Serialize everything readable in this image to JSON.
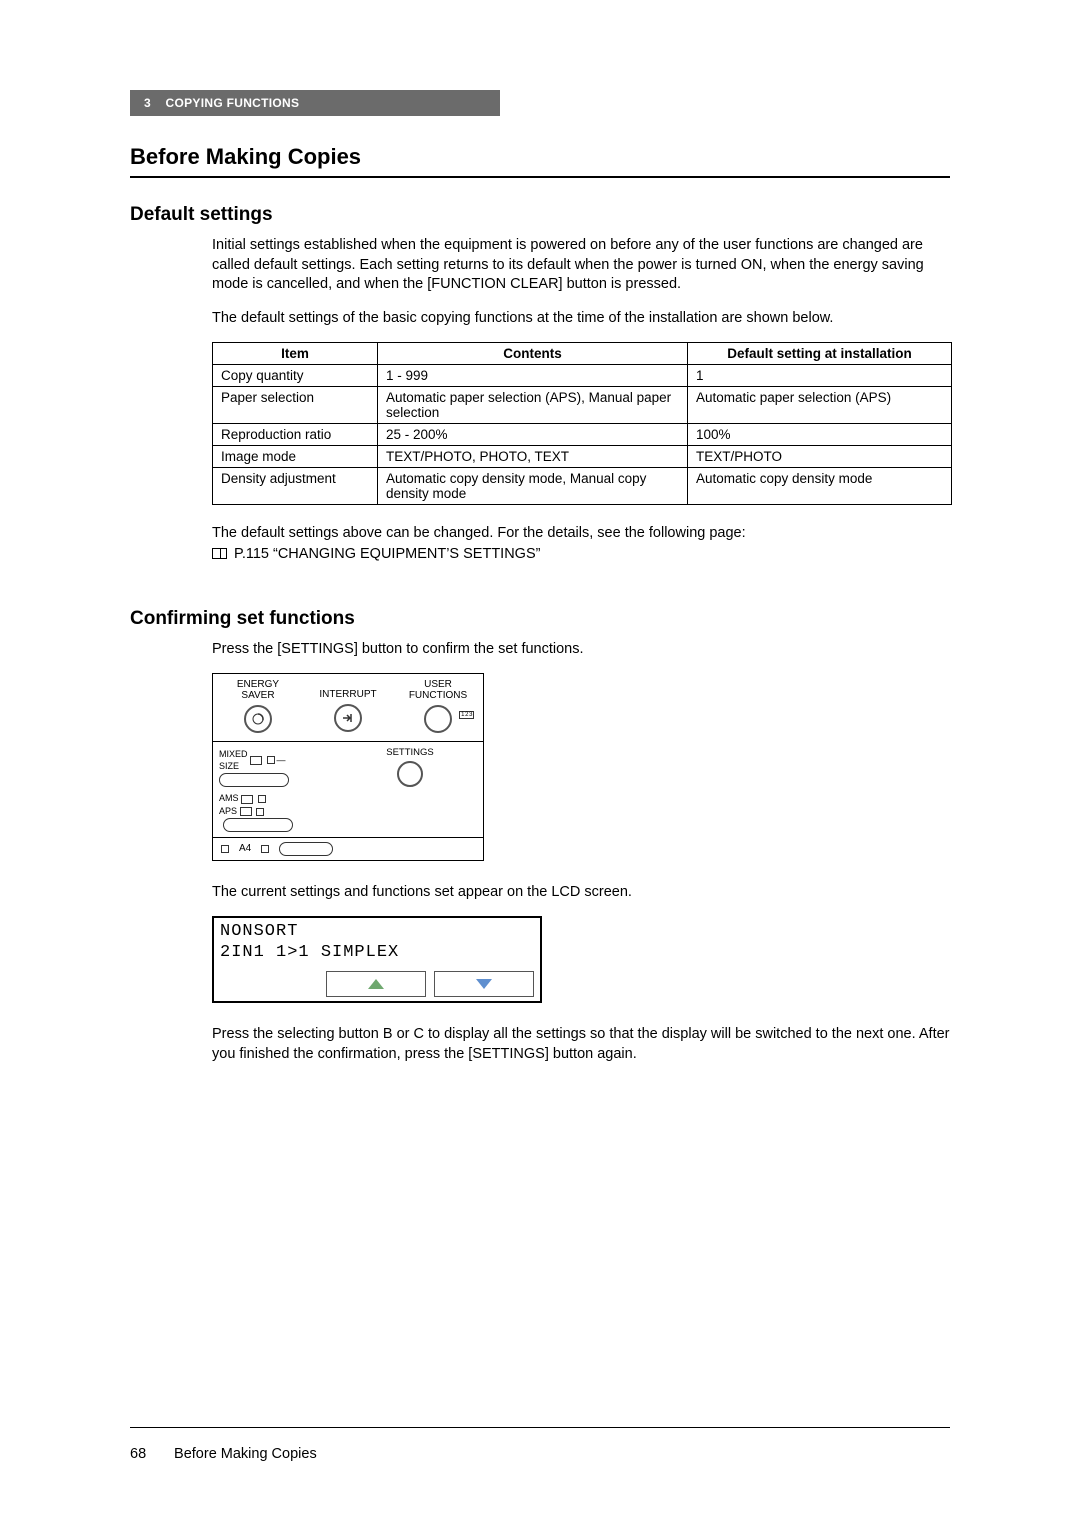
{
  "header": {
    "chapter": "3",
    "chapter_title": "COPYING FUNCTIONS"
  },
  "title": "Before Making Copies",
  "sections": {
    "default_settings": {
      "heading": "Default settings",
      "para1": "Initial settings established when the equipment is powered on before any of the user functions are changed are called default settings. Each setting returns to its default when the power is turned ON, when the energy saving mode is cancelled, and when the [FUNCTION CLEAR] button is pressed.",
      "para2": "The default settings of the basic copying functions at the time of the installation are shown below.",
      "table": {
        "headers": [
          "Item",
          "Contents",
          "Default setting at installation"
        ],
        "rows": [
          [
            "Copy quantity",
            "1 - 999",
            "1"
          ],
          [
            "Paper selection",
            "Automatic paper selection (APS), Manual paper selection",
            "Automatic paper selection (APS)"
          ],
          [
            "Reproduction ratio",
            "25 - 200%",
            "100%"
          ],
          [
            "Image mode",
            "TEXT/PHOTO, PHOTO, TEXT",
            "TEXT/PHOTO"
          ],
          [
            "Density adjustment",
            "Automatic copy density mode, Manual copy density mode",
            "Automatic copy density mode"
          ]
        ]
      },
      "ref_text": "The default settings above can be changed. For the details, see the following page:",
      "ref_link": "P.115 “CHANGING EQUIPMENT’S SETTINGS”"
    },
    "confirming": {
      "heading": "Confirming set functions",
      "para1": "Press the [SETTINGS] button to confirm the set functions.",
      "panel": {
        "labels": {
          "energy_saver": "ENERGY\nSAVER",
          "interrupt": "INTERRUPT",
          "user_functions": "USER\nFUNCTIONS",
          "mixed_size": "MIXED\nSIZE",
          "ams": "AMS",
          "aps": "APS",
          "settings": "SETTINGS",
          "a4": "A4",
          "icon_123": "1 2 3"
        }
      },
      "para2": "The current settings and functions set appear on the LCD screen.",
      "lcd": {
        "line1": "NONSORT",
        "line2": "2IN1 1>1 SIMPLEX"
      },
      "para3": "Press the selecting button B or C to display all the settings so that the display will be switched to the next one. After you finished the confirmation, press the [SETTINGS] button again."
    }
  },
  "footer": {
    "page_number": "68",
    "title": "Before Making Copies"
  }
}
